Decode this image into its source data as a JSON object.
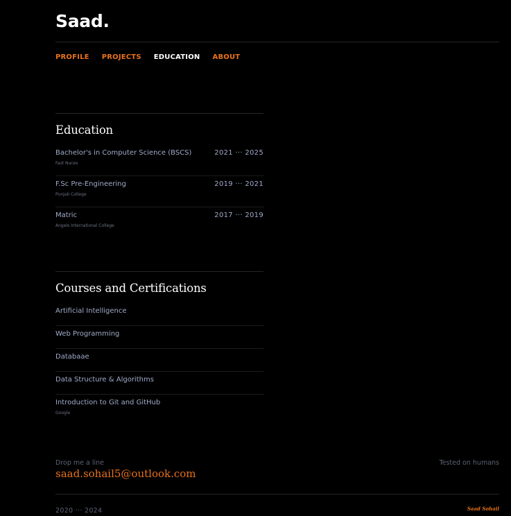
{
  "brand": {
    "logo": "Saad."
  },
  "nav": {
    "items": [
      {
        "label": "PROFILE",
        "active": false
      },
      {
        "label": "PROJECTS",
        "active": false
      },
      {
        "label": "EDUCATION",
        "active": true
      },
      {
        "label": "ABOUT",
        "active": false
      }
    ]
  },
  "education": {
    "heading": "Education",
    "items": [
      {
        "title": "Bachelor's in Computer Science (BSCS)",
        "institution": "Fast Nuces",
        "years": "2021 ··· 2025"
      },
      {
        "title": "F.Sc Pre-Engineering",
        "institution": "Punjab College",
        "years": "2019 ··· 2021"
      },
      {
        "title": "Matric",
        "institution": "Angels International College",
        "years": "2017 ··· 2019"
      }
    ]
  },
  "courses": {
    "heading": "Courses and Certifications",
    "items": [
      {
        "title": "Artificial Intelligence",
        "provider": ""
      },
      {
        "title": "Web Programming",
        "provider": ""
      },
      {
        "title": "Databaae",
        "provider": ""
      },
      {
        "title": "Data Structure & Algorithms",
        "provider": ""
      },
      {
        "title": "Introduction to Git and GitHub",
        "provider": "Google"
      }
    ]
  },
  "footer": {
    "drop_label": "Drop me a line",
    "email": "saad.sohail5@outlook.com",
    "tested": "Tested on humans",
    "years": "2020 ··· 2024",
    "signature": "Saad Sohail"
  },
  "colors": {
    "accent": "#e8721c",
    "background": "#000000",
    "text": "#a2accb"
  }
}
